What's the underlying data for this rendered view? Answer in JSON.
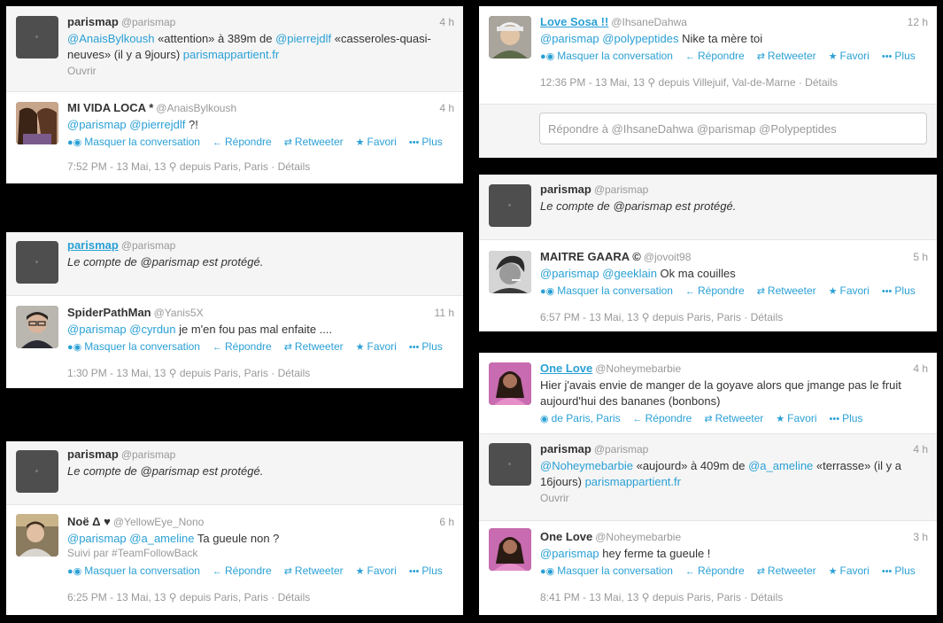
{
  "panel1": {
    "t1": {
      "name": "parismap",
      "handle": "@parismap",
      "time": "4 h",
      "m1": "@AnaisBylkoush",
      "txt1": " «attention» à 389m de ",
      "m2": "@pierrejdlf",
      "txt2": " «casseroles-quasi-neuves» (il y a 9jours) ",
      "link": "parismappartient.fr",
      "sub": "Ouvrir"
    },
    "t2": {
      "name": "MI VIDA LOCA *",
      "handle": "@AnaisBylkoush",
      "time": "4 h",
      "m1": "@parismap",
      "m2": "@pierrejdlf",
      "txt": " ?!",
      "meta": "7:52 PM - 13 Mai, 13",
      "loc": "depuis Paris, Paris · Détails"
    }
  },
  "panel2": {
    "t1": {
      "name": "parismap",
      "handle": "@parismap",
      "text": "Le compte de @parismap est protégé."
    },
    "t2": {
      "name": "SpiderPathMan",
      "handle": "@Yanis5X",
      "time": "11 h",
      "m1": "@parismap",
      "m2": "@cyrdun",
      "txt": " je m'en fou pas mal enfaite ....",
      "meta": "1:30 PM - 13 Mai, 13",
      "loc": "depuis Paris, Paris · Détails"
    }
  },
  "panel3": {
    "t1": {
      "name": "parismap",
      "handle": "@parismap",
      "text": "Le compte de @parismap est protégé."
    },
    "t2": {
      "name": "Noë Δ ♥",
      "handle": "@YellowEye_Nono",
      "time": "6 h",
      "m1": "@parismap",
      "m2": "@a_ameline",
      "txt": " Ta gueule non ?",
      "sub": "Suivi par #TeamFollowBack",
      "meta": "6:25 PM - 13 Mai, 13",
      "loc": "depuis Paris, Paris · Détails"
    }
  },
  "panel4": {
    "t1": {
      "name": "Love Sosa !!",
      "handle": "@IhsaneDahwa",
      "time": "12 h",
      "m1": "@parismap",
      "m2": "@polypeptides",
      "txt": " Nike ta mère toi",
      "meta": "12:36 PM - 13 Mai, 13",
      "loc": "depuis Villejuif, Val-de-Marne · Détails"
    },
    "reply_placeholder": "Répondre à @IhsaneDahwa @parismap @Polypeptides"
  },
  "panel5": {
    "t1": {
      "name": "parismap",
      "handle": "@parismap",
      "text": "Le compte de @parismap est protégé."
    },
    "t2": {
      "name": "MAITRE GAARA ©",
      "handle": "@jovoit98",
      "time": "5 h",
      "m1": "@parismap",
      "m2": "@geeklain",
      "txt": " Ok ma couilles",
      "meta": "6:57 PM - 13 Mai, 13",
      "loc": "depuis Paris, Paris · Détails"
    }
  },
  "panel6": {
    "t1": {
      "name": "One Love",
      "handle": "@Noheymebarbie",
      "time": "4 h",
      "text": "Hier j'avais envie de manger de la goyave alors que jmange pas le fruit aujourd'hui des bananes (bonbons)",
      "loc_action": "de Paris, Paris"
    },
    "t2": {
      "name": "parismap",
      "handle": "@parismap",
      "time": "4 h",
      "m1": "@Noheymebarbie",
      "txt1": " «aujourd» à 409m de ",
      "m2": "@a_ameline",
      "txt2": " «terrasse» (il y a 16jours) ",
      "link": "parismappartient.fr",
      "sub": "Ouvrir"
    },
    "t3": {
      "name": "One Love",
      "handle": "@Noheymebarbie",
      "time": "3 h",
      "m1": "@parismap",
      "txt": " hey ferme ta gueule !",
      "meta": "8:41 PM - 13 Mai, 13",
      "loc": "depuis Paris, Paris · Détails"
    }
  },
  "actions": {
    "hide": "Masquer la conversation",
    "reply": "Répondre",
    "retweet": "Retweeter",
    "fav": "Favori",
    "more": "Plus"
  },
  "icons": {
    "reply": "reply-arrow-icon",
    "retweet": "retweet-icon",
    "fav": "star-icon",
    "more": "more-dots-icon",
    "conversation": "conversation-icon",
    "location": "location-pin-icon"
  },
  "colors": {
    "link": "#2aa0d5",
    "muted": "#999999",
    "text": "#333333",
    "background": "#000000"
  }
}
